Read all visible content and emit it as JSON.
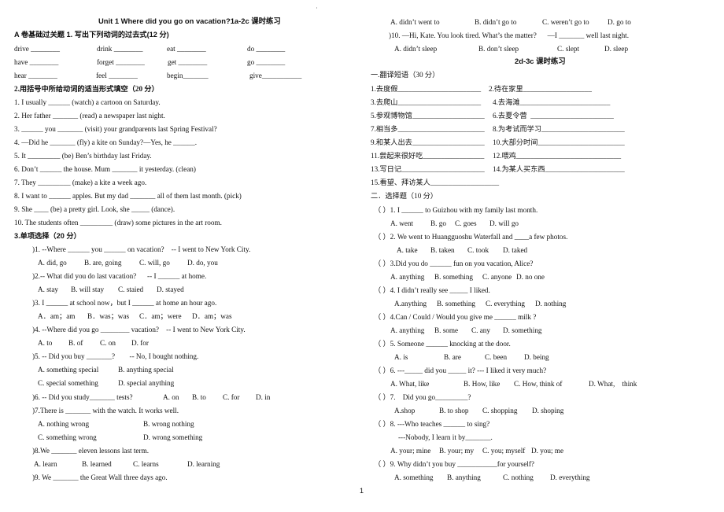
{
  "document": {
    "page_number": "1",
    "left_column": {
      "title": "Unit 1 Where did you go on vacation?1a-2c 课时练习",
      "section_a": {
        "heading": "A 卷基础过关题 1. 写出下列动词的过去式(12 分)",
        "verbs": [
          [
            "drive ________",
            "drink ________",
            "eat ________",
            "do ________"
          ],
          [
            "have ________",
            "forget ________",
            "get ________",
            "go ________"
          ],
          [
            "hear ________",
            "feel ________",
            "begin_______",
            "give___________"
          ]
        ]
      },
      "section_2": {
        "heading": "2.用括号中所给动词的适当形式填空（20 分）",
        "items": [
          "1. I usually ______ (watch) a cartoon on Saturday.",
          "2. Her father _______ (read) a newspaper last night.",
          "3. ______ you _______ (visit) your grandparents last Spring Festival?",
          "4. —Did he _______ (fly) a kite on Sunday?—Yes, he ______.",
          "5. It _________ (be) Ben’s birthday last Friday.",
          "6. Don’t ______ the house. Mum _______ it yesterday. (clean)",
          "7. They _________ (make) a kite a week ago.",
          "8. I want to ______ apples. But my dad _______ all of them last month. (pick)",
          "9. She ____ (be) a pretty girl. Look, she _____ (dance).",
          "10. The students often _________ (draw) some pictures in the art room."
        ]
      },
      "section_3": {
        "heading": "3.单项选择（20 分）",
        "questions": [
          {
            "stem": ")1. --Where ______ you ______ on vacation?    -- I went to New York City.",
            "options": [
              "A. did, go",
              "B. are, going",
              "C. will, go",
              "D. do, you"
            ]
          },
          {
            "stem": ")2.-- What did you do last vacation?      -- I ______ at home.",
            "options": [
              "A. stay",
              "B. will stay",
              "C. staied",
              "D. stayed"
            ]
          },
          {
            "stem": ")3. I ______ at school now，but I ______ at home an hour ago.",
            "options": [
              "A．am；am",
              "B．was；was",
              "C．am；were",
              "D．am；was"
            ]
          },
          {
            "stem": ")4. --Where did you go ________ vacation?    -- I went to New York City.",
            "options": [
              "A. to",
              "B. of",
              "C. on",
              "D. for"
            ]
          },
          {
            "stem": ")5. -- Did you buy _______?        -- No, I bought nothing.",
            "options": [
              "A. something special",
              "B. anything special",
              "C. special something",
              "D. special anything"
            ]
          },
          {
            "stem": ")6. -- Did you study_______ tests?",
            "options": [
              "A. on",
              "B. to",
              "C. for",
              "D. in"
            ]
          },
          {
            "stem": ")7.There is _______ with the watch. It works well.",
            "options": [
              "A. nothing wrong",
              "B. wrong nothing",
              "C. something wrong",
              "D. wrong something"
            ]
          },
          {
            "stem": ")8.We _______ eleven lessons last term.",
            "options": [
              "A. learn",
              "B. learned",
              "C. learns",
              "D. learning"
            ]
          },
          {
            "stem": ")9. We _______ the Great Wall three days ago.",
            "options": []
          }
        ]
      }
    },
    "right_column": {
      "q9_options": [
        "A. didn’t went to",
        "B. didn’t go to",
        "C. weren’t go to",
        "D. go to"
      ],
      "q10": {
        "stem": ")10. —Hi, Kate. You look tired. What’s the matter?      —I _______ well last night.",
        "options": [
          "A. didn’t sleep",
          "B. don’t sleep",
          "C. slept",
          "D. sleep"
        ]
      },
      "title": "2d-3c 课时练习",
      "section_1": {
        "heading": "一.翻译短语（30 分）",
        "phrases": [
          [
            "1.去度假_______________________",
            "2.待在家里___________________"
          ],
          [
            "3.去爬山_______________________",
            "4.去海滩_________________________"
          ],
          [
            "5.参观博物馆____________________",
            "6.去夏令营  _______________________"
          ],
          [
            "7.相当多________________________",
            "8.为考试而学习_______________________"
          ],
          [
            "9.和某人出去____________________",
            "10.大部分时间________________________"
          ],
          [
            "11.尝起来很好吃_________________",
            "12.喂鸡_____________________________"
          ],
          [
            "13.写日记_______________________",
            "14.为某人买东西______________________"
          ],
          [
            "15.看望、拜访某人___________________"
          ]
        ]
      },
      "section_2": {
        "heading": "二．选择题（10 分）",
        "questions": [
          {
            "stem": "（ ）1. I ______ to Guizhou with my family last month.",
            "options": [
              "A. went",
              "B. go",
              "C. goes",
              "D. will go"
            ]
          },
          {
            "stem": "（ ）2. We went to Huangguoshu Waterfall and ____a few photos.",
            "options": [
              "A. take",
              "B. taken",
              "C. took",
              "D. taked"
            ]
          },
          {
            "stem": "（ ）3.Did you do ______ fun on you vacation, Alice?",
            "options": [
              "A. anything",
              "B. something",
              "C. anyone",
              "D. no one"
            ]
          },
          {
            "stem": "（ ）4. I didn’t really see _____ I liked.",
            "options": [
              "A.anything",
              "B. something",
              "C. everything",
              "D. nothing"
            ]
          },
          {
            "stem": "（ ）4.Can / Could / Would you give me ______ milk ?",
            "options": [
              "A. anything",
              "B. some",
              "C. any",
              "D. something"
            ]
          },
          {
            "stem": "（ ）5. Someone ______ knocking at the door.",
            "options": [
              "A. is",
              "B. are",
              "C. been",
              "D. being"
            ]
          },
          {
            "stem": "（ ）6. ---_____ did you _____ it? --- I liked it very much?",
            "options": [
              "A. What, like",
              "B. How, like",
              "C. How, think of",
              "D. What,    think"
            ]
          },
          {
            "stem": "（ ）7.    Did you go_________?",
            "options": [
              "A.shop",
              "B. to shop",
              "C. shopping",
              "D. shoping"
            ]
          },
          {
            "stem": "（ ）8. ---Who teaches ______ to sing?",
            "stem2": "---Nobody, I learn it by_______.",
            "options": [
              "A. your; mine",
              "B. your; my",
              "C. you; myself",
              "D. you; me"
            ]
          },
          {
            "stem": "（ ）9. Why didn’t you buy ___________for yourself?",
            "options": [
              "A. something",
              "B. anything",
              "C. nothing",
              "D. everything"
            ]
          }
        ]
      }
    },
    "paren_open": "("
  }
}
